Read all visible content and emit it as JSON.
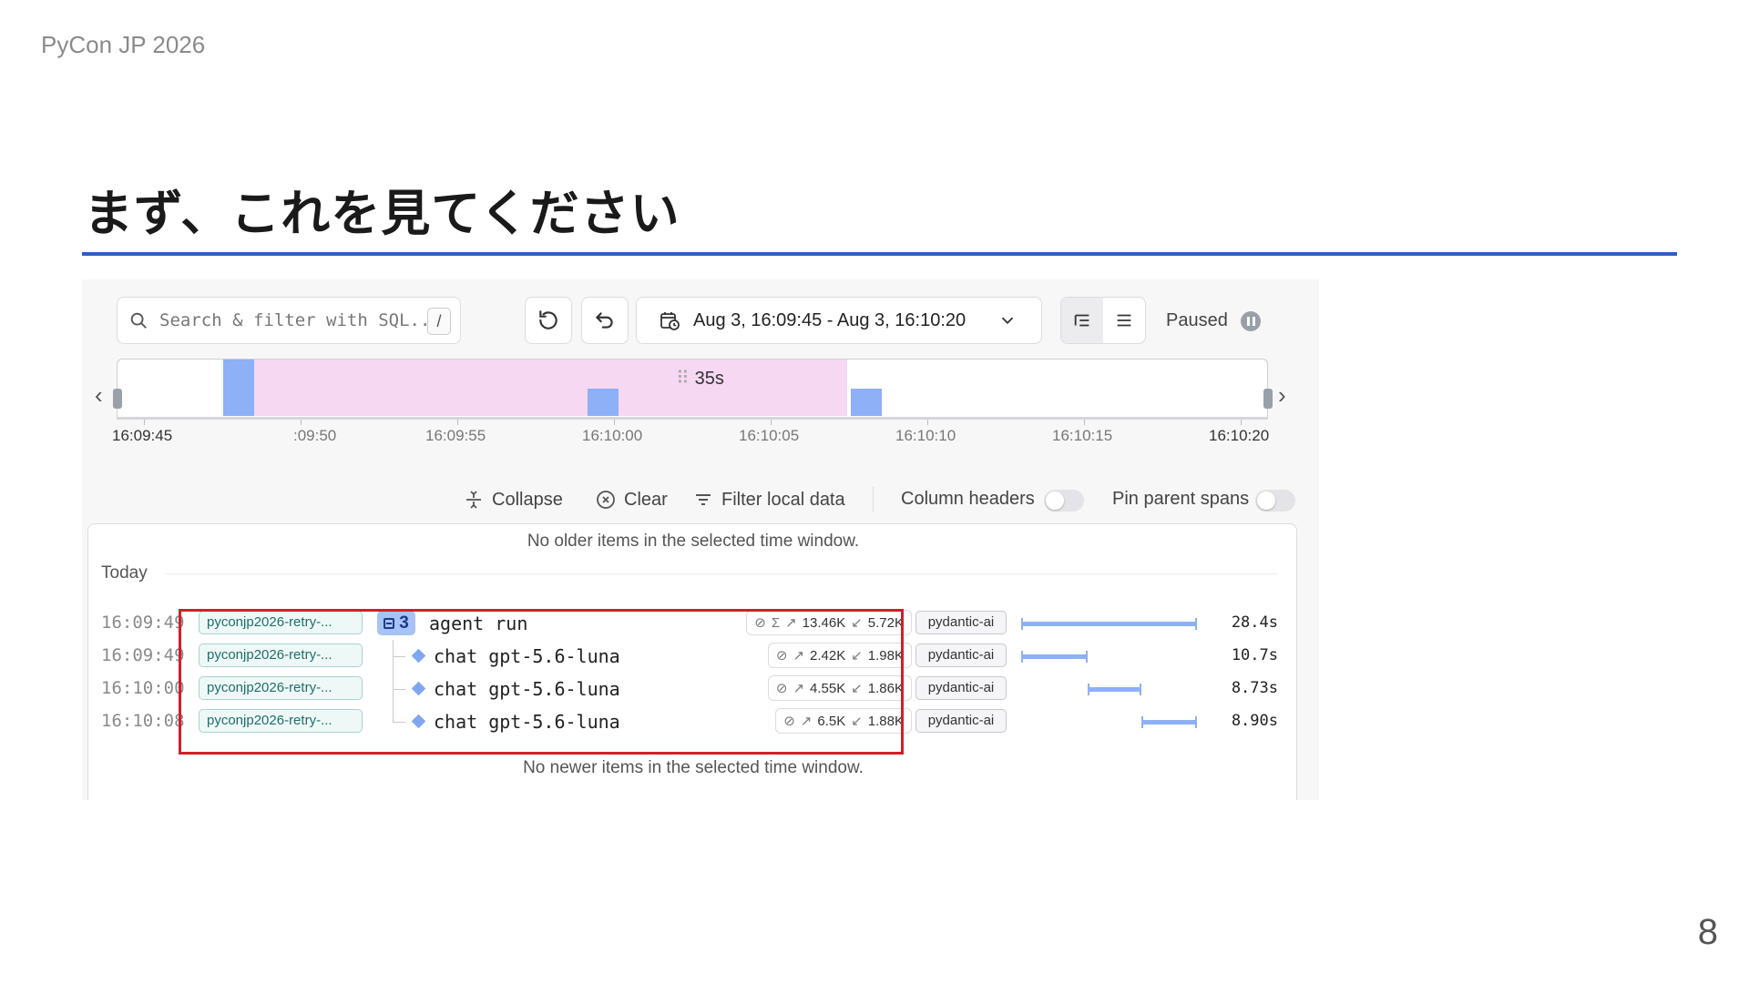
{
  "slide": {
    "conference": "PyCon JP 2026",
    "title": "まず、これを見てください",
    "page_number": "8"
  },
  "toolbar": {
    "search_placeholder": "Search & filter with SQL...",
    "search_shortcut": "/",
    "time_range": "Aug 3, 16:09:45 - Aug 3, 16:10:20",
    "status": "Paused"
  },
  "timeline": {
    "selection_label": "35s",
    "ticks": [
      "16:09:45",
      ":09:50",
      "16:09:55",
      "16:10:00",
      "16:10:05",
      "16:10:10",
      "16:10:15",
      "16:10:20"
    ]
  },
  "options": {
    "collapse": "Collapse",
    "clear": "Clear",
    "filter": "Filter local data",
    "column_headers": "Column headers",
    "pin_parent": "Pin parent spans"
  },
  "list": {
    "older_notice": "No older items in the selected time window.",
    "newer_notice": "No newer items in the selected time window.",
    "group_label": "Today",
    "rows": [
      {
        "time": "16:09:49",
        "service": "pyconjp2026-retry-...",
        "count": "3",
        "name": "agent run",
        "tokens_sigma": "Σ",
        "tokens_in": "13.46K",
        "tokens_out": "5.72K",
        "scope": "pydantic-ai",
        "duration": "28.4s",
        "bar_start": 0.0,
        "bar_end": 1.0
      },
      {
        "time": "16:09:49",
        "service": "pyconjp2026-retry-...",
        "name": "chat gpt-5.6-luna",
        "tokens_in": "2.42K",
        "tokens_out": "1.98K",
        "scope": "pydantic-ai",
        "duration": "10.7s",
        "bar_start": 0.0,
        "bar_end": 0.377
      },
      {
        "time": "16:10:00",
        "service": "pyconjp2026-retry-...",
        "name": "chat gpt-5.6-luna",
        "tokens_in": "4.55K",
        "tokens_out": "1.86K",
        "scope": "pydantic-ai",
        "duration": "8.73s",
        "bar_start": 0.377,
        "bar_end": 0.685
      },
      {
        "time": "16:10:08",
        "service": "pyconjp2026-retry-...",
        "name": "chat gpt-5.6-luna",
        "tokens_in": "6.5K",
        "tokens_out": "1.88K",
        "scope": "pydantic-ai",
        "duration": "8.90s",
        "bar_start": 0.685,
        "bar_end": 1.0
      }
    ]
  },
  "colors": {
    "accent_rule": "#2f5fc4",
    "highlight": "#d0202a",
    "selection": "#f6d8f3",
    "bar": "#8db0f7"
  }
}
